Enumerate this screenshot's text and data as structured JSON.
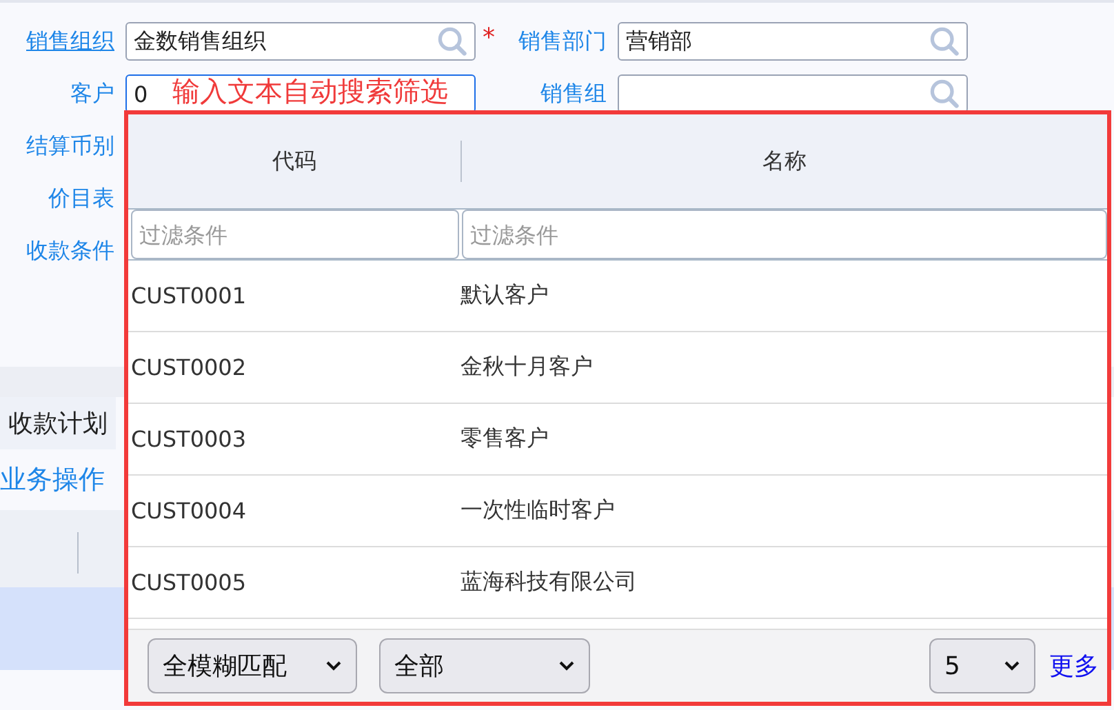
{
  "form": {
    "left_fields": [
      {
        "label": "销售组织",
        "link": true,
        "kind": "lookup",
        "value": "金数销售组织",
        "required_mark": "*",
        "focused": false
      },
      {
        "label": "客户",
        "link": false,
        "kind": "lookup",
        "value": "0",
        "focused": true
      },
      {
        "label": "结算币别",
        "link": false,
        "kind": "label"
      },
      {
        "label": "价目表",
        "link": false,
        "kind": "label"
      },
      {
        "label": "收款条件",
        "link": false,
        "kind": "label"
      }
    ],
    "right_fields": [
      {
        "label": "销售部门",
        "link": false,
        "kind": "lookup",
        "value": "营销部",
        "focused": false
      },
      {
        "label": "销售组",
        "link": false,
        "kind": "lookup",
        "focused": false
      }
    ]
  },
  "annotation": "输入文本自动搜索筛选",
  "tabs": [
    {
      "label": "收款计划"
    }
  ],
  "business_ops": "业务操作",
  "popup": {
    "columns": [
      "代码",
      "名称"
    ],
    "filter_placeholders": [
      "过滤条件",
      "过滤条件"
    ],
    "rows": [
      {
        "code": "CUST0001",
        "name": "默认客户"
      },
      {
        "code": "CUST0002",
        "name": "金秋十月客户"
      },
      {
        "code": "CUST0003",
        "name": "零售客户"
      },
      {
        "code": "CUST0004",
        "name": "一次性临时客户"
      },
      {
        "code": "CUST0005",
        "name": "蓝海科技有限公司"
      }
    ],
    "match_mode": "全模糊匹配",
    "scope": "全部",
    "page_size": "5",
    "more": "更多"
  }
}
